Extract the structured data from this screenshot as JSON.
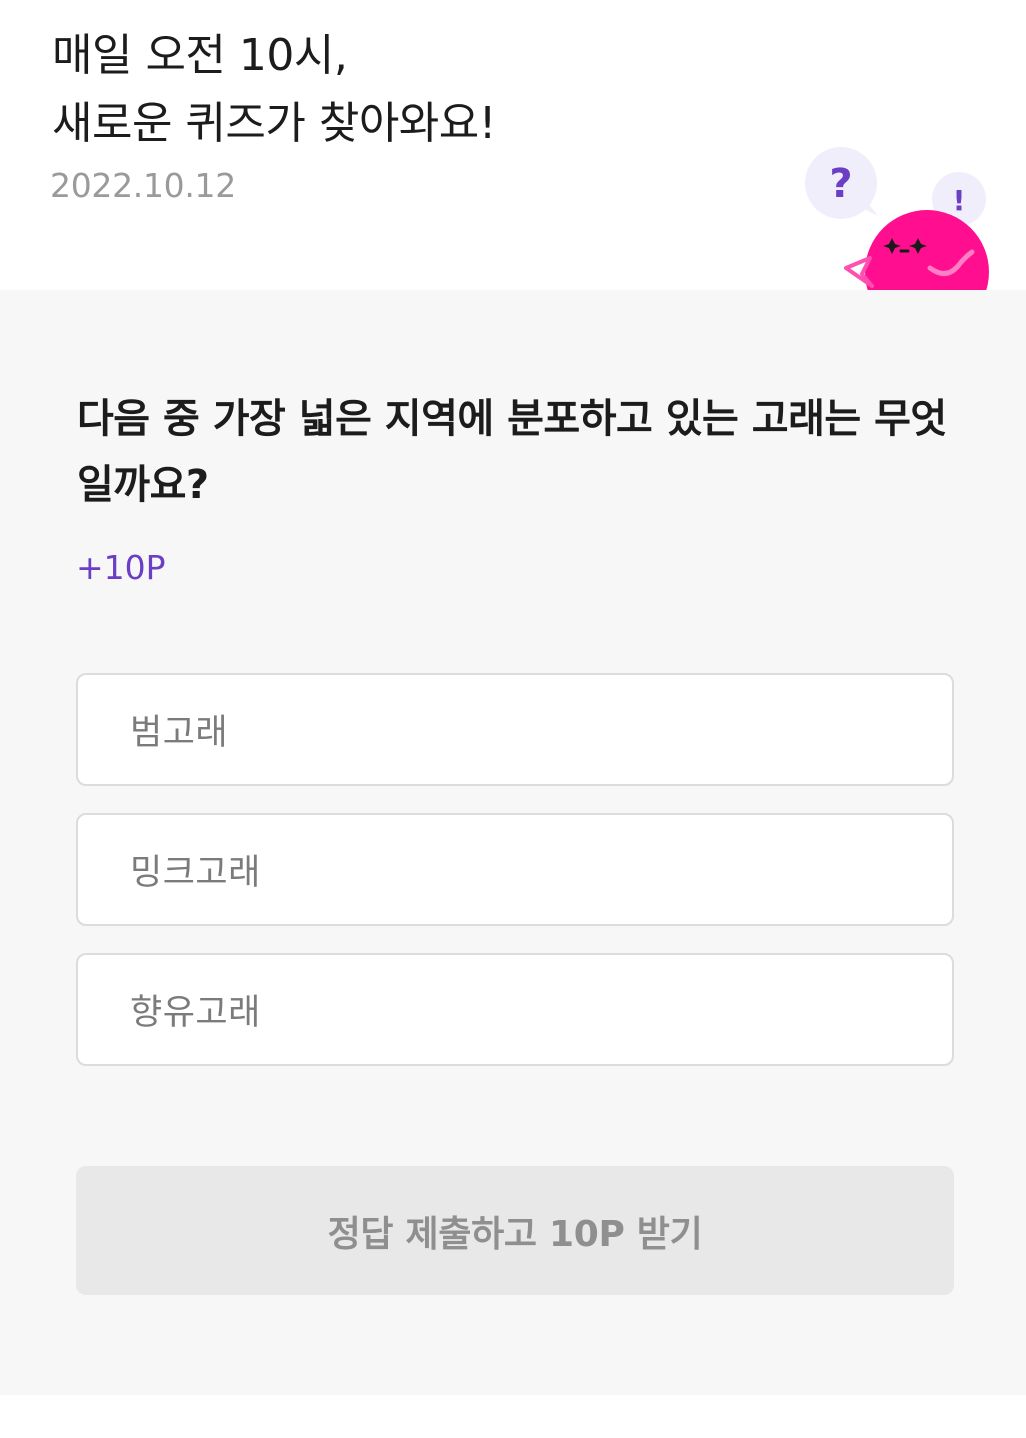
{
  "header": {
    "headline_line1": "매일 오전 10시,",
    "headline_line2": "새로운 퀴즈가 찾아와요!",
    "date": "2022.10.12"
  },
  "mascot": {
    "question_mark": "?",
    "exclamation_mark": "!",
    "body_color": "#ff0f8f",
    "bubble_color": "#f1eefb",
    "mark_color": "#6a3fc6"
  },
  "quiz": {
    "question": "다음 중 가장 넓은 지역에 분포하고 있는 고래는 무엇일까요?",
    "reward": "+10P",
    "options": [
      {
        "label": "범고래"
      },
      {
        "label": "밍크고래"
      },
      {
        "label": "향유고래"
      }
    ],
    "submit_label": "정답 제출하고 10P 받기"
  },
  "colors": {
    "accent": "#6a3fc6",
    "section_background": "#f7f7f7",
    "submit_disabled_background": "#e8e8e8"
  }
}
